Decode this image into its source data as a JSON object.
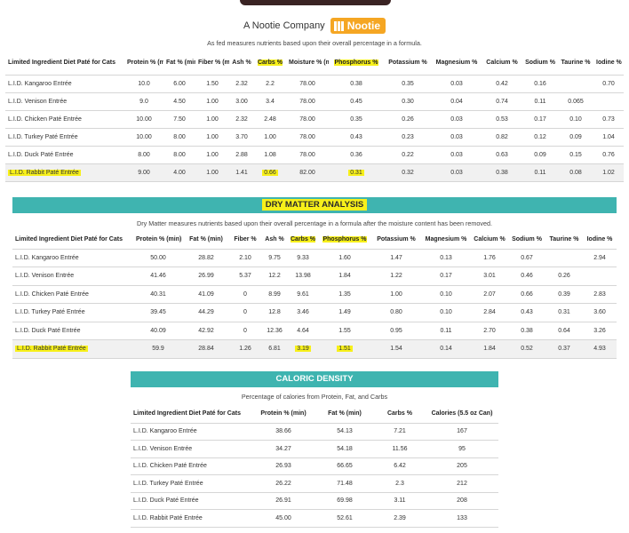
{
  "brand": {
    "company_text": "A Nootie Company",
    "logo_text": "Nootie",
    "accent": "#f5a623"
  },
  "colors": {
    "teal": "#3fb4b0",
    "highlight": "#f7f01a"
  },
  "as_fed": {
    "caption": "As fed measures nutrients based upon their overall percentage in a formula.",
    "headers": [
      "Limited Ingredient Diet Paté for Cats",
      "Protein % (min)",
      "Fat % (min)",
      "Fiber % (max)",
      "Ash %",
      "Carbs %",
      "Moisture % (max)",
      "Phosphorus %",
      "Potassium %",
      "Magnesium %",
      "Calcium %",
      "Sodium %",
      "Taurine %",
      "Iodine %"
    ],
    "rows": [
      [
        "L.I.D. Kangaroo Entrée",
        "10.0",
        "6.00",
        "1.50",
        "2.32",
        "2.2",
        "78.00",
        "0.38",
        "0.35",
        "0.03",
        "0.42",
        "0.16",
        "",
        "0.70"
      ],
      [
        "L.I.D. Venison Entrée",
        "9.0",
        "4.50",
        "1.00",
        "3.00",
        "3.4",
        "78.00",
        "0.45",
        "0.30",
        "0.04",
        "0.74",
        "0.11",
        "0.065",
        ""
      ],
      [
        "L.I.D. Chicken Paté Entrée",
        "10.00",
        "7.50",
        "1.00",
        "2.32",
        "2.48",
        "78.00",
        "0.35",
        "0.26",
        "0.03",
        "0.53",
        "0.17",
        "0.10",
        "0.73"
      ],
      [
        "L.I.D. Turkey Paté Entrée",
        "10.00",
        "8.00",
        "1.00",
        "3.70",
        "1.00",
        "78.00",
        "0.43",
        "0.23",
        "0.03",
        "0.82",
        "0.12",
        "0.09",
        "1.04"
      ],
      [
        "L.I.D. Duck Paté Entrée",
        "8.00",
        "8.00",
        "1.00",
        "2.88",
        "1.08",
        "78.00",
        "0.36",
        "0.22",
        "0.03",
        "0.63",
        "0.09",
        "0.15",
        "0.76"
      ],
      [
        "L.I.D. Rabbit Paté Entrée",
        "9.00",
        "4.00",
        "1.00",
        "1.41",
        "0.66",
        "82.00",
        "0.31",
        "0.32",
        "0.03",
        "0.38",
        "0.11",
        "0.08",
        "1.02"
      ]
    ]
  },
  "dry_matter": {
    "title": "DRY MATTER ANALYSIS",
    "caption": "Dry Matter measures nutrients based upon their overall percentage in a formula after the moisture content has been removed.",
    "headers": [
      "Limited Ingredient Diet Paté for Cats",
      "Protein % (min)",
      "Fat % (min)",
      "Fiber %",
      "Ash %",
      "Carbs %",
      "Phosphorus %",
      "Potassium %",
      "Magnesium %",
      "Calcium %",
      "Sodium %",
      "Taurine %",
      "Iodine %"
    ],
    "rows": [
      [
        "L.I.D. Kangaroo Entrée",
        "50.00",
        "28.82",
        "2.10",
        "9.75",
        "9.33",
        "1.60",
        "1.47",
        "0.13",
        "1.76",
        "0.67",
        "",
        "2.94"
      ],
      [
        "L.I.D. Venison Entrée",
        "41.46",
        "26.99",
        "5.37",
        "12.2",
        "13.98",
        "1.84",
        "1.22",
        "0.17",
        "3.01",
        "0.46",
        "0.26",
        ""
      ],
      [
        "L.I.D. Chicken Paté Entrée",
        "40.31",
        "41.09",
        "0",
        "8.99",
        "9.61",
        "1.35",
        "1.00",
        "0.10",
        "2.07",
        "0.66",
        "0.39",
        "2.83"
      ],
      [
        "L.I.D. Turkey Paté Entrée",
        "39.45",
        "44.29",
        "0",
        "12.8",
        "3.46",
        "1.49",
        "0.80",
        "0.10",
        "2.84",
        "0.43",
        "0.31",
        "3.60"
      ],
      [
        "L.I.D. Duck Paté Entrée",
        "40.09",
        "42.92",
        "0",
        "12.36",
        "4.64",
        "1.55",
        "0.95",
        "0.11",
        "2.70",
        "0.38",
        "0.64",
        "3.26"
      ],
      [
        "L.I.D. Rabbit Paté Entrée",
        "59.9",
        "28.84",
        "1.26",
        "6.81",
        "3.19",
        "1.51",
        "1.54",
        "0.14",
        "1.84",
        "0.52",
        "0.37",
        "4.93"
      ]
    ]
  },
  "caloric": {
    "title": "CALORIC DENSITY",
    "caption": "Percentage of calories from Protein, Fat, and Carbs",
    "headers": [
      "Limited Ingredient Diet Paté for Cats",
      "Protein % (min)",
      "Fat % (min)",
      "Carbs %",
      "Calories (5.5 oz Can)"
    ],
    "rows": [
      [
        "L.I.D. Kangaroo Entrée",
        "38.66",
        "54.13",
        "7.21",
        "167"
      ],
      [
        "L.I.D. Venison Entrée",
        "34.27",
        "54.18",
        "11.56",
        "95"
      ],
      [
        "L.I.D. Chicken Paté Entrée",
        "26.93",
        "66.65",
        "6.42",
        "205"
      ],
      [
        "L.I.D. Turkey Paté Entrée",
        "26.22",
        "71.48",
        "2.3",
        "212"
      ],
      [
        "L.I.D. Duck Paté Entrée",
        "26.91",
        "69.98",
        "3.11",
        "208"
      ],
      [
        "L.I.D. Rabbit Paté Entrée",
        "45.00",
        "52.61",
        "2.39",
        "133"
      ]
    ]
  }
}
